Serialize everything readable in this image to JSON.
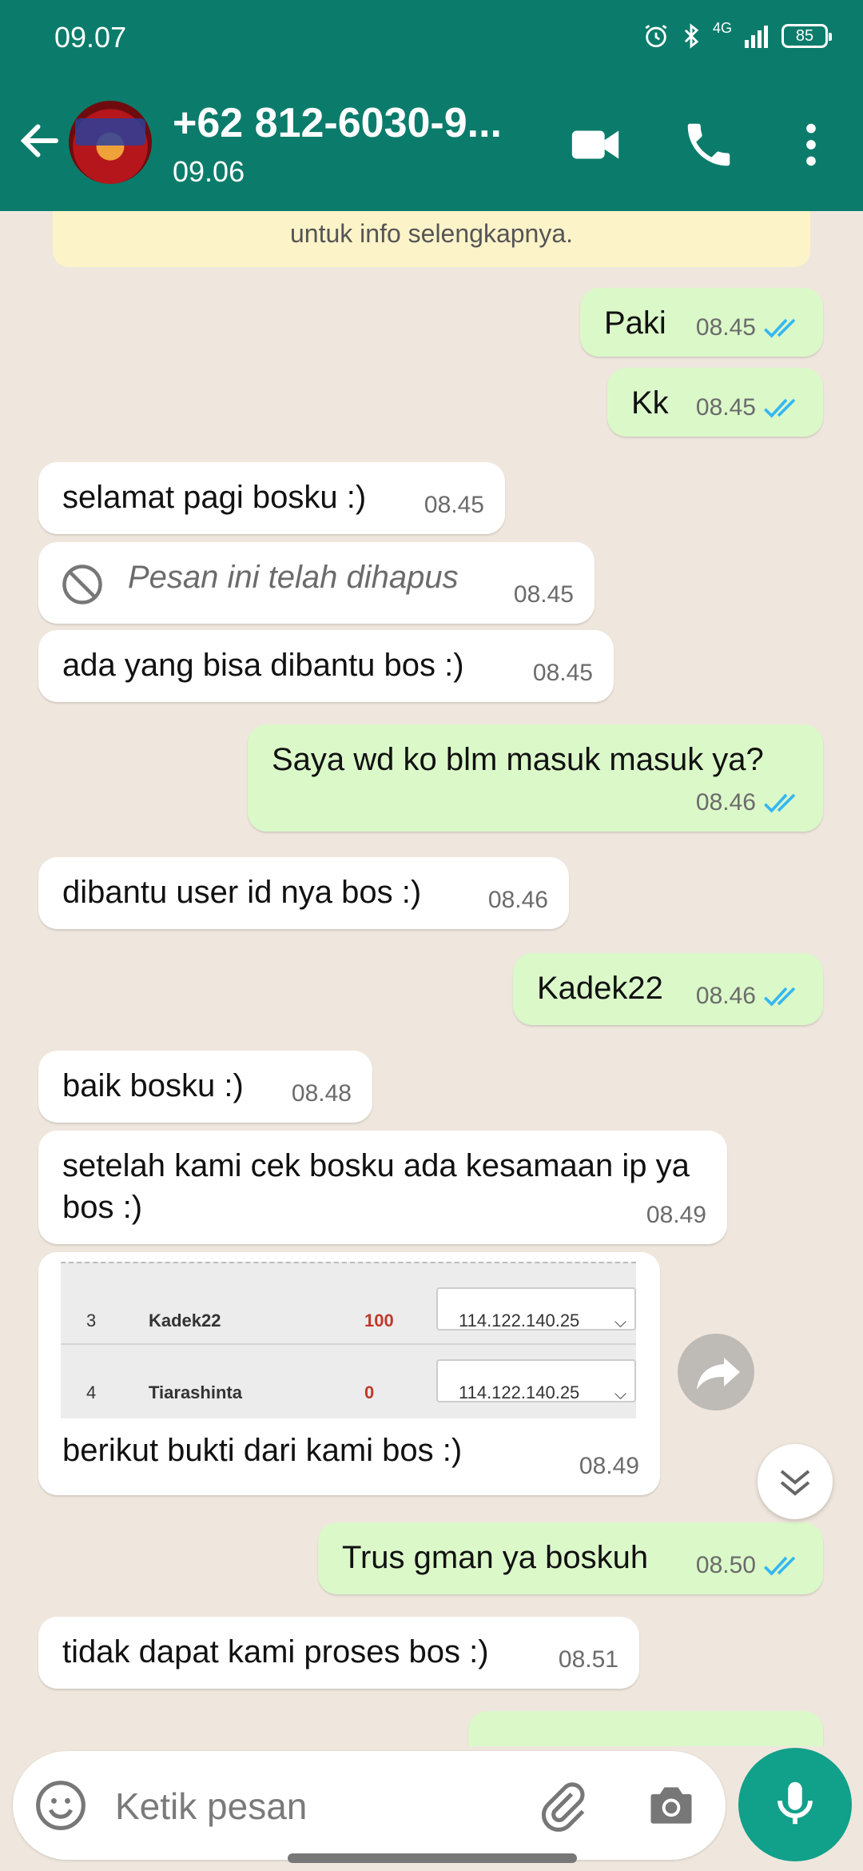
{
  "status_bar": {
    "time": "09.07",
    "network": "4G",
    "battery": "85"
  },
  "header": {
    "contact_name": "+62 812-6030-9...",
    "last_seen": "09.06"
  },
  "chat": {
    "notice_text": "untuk info selengkapnya.",
    "messages": [
      {
        "dir": "out",
        "text": "Paki",
        "time": "08.45",
        "read": true
      },
      {
        "dir": "out",
        "text": "Kk",
        "time": "08.45",
        "read": true
      },
      {
        "dir": "in",
        "text": "selamat pagi bosku :)",
        "time": "08.45"
      },
      {
        "dir": "in",
        "text": "Pesan ini telah dihapus",
        "time": "08.45",
        "deleted": true
      },
      {
        "dir": "in",
        "text": "ada  yang bisa dibantu bos :)",
        "time": "08.45"
      },
      {
        "dir": "out",
        "text": "Saya wd ko blm masuk masuk ya?",
        "time": "08.46",
        "read": true
      },
      {
        "dir": "in",
        "text": "dibantu  user id nya bos :)",
        "time": "08.46"
      },
      {
        "dir": "out",
        "text": "Kadek22",
        "time": "08.46",
        "read": true
      },
      {
        "dir": "in",
        "text": "baik bosku :)",
        "time": "08.48"
      },
      {
        "dir": "in",
        "text": "setelah kami cek bosku ada kesamaan ip ya bos :)",
        "time": "08.49"
      },
      {
        "dir": "in",
        "text": "berikut bukti dari kami bos :)",
        "time": "08.49",
        "image": true
      },
      {
        "dir": "out",
        "text": "Trus gman ya boskuh",
        "time": "08.50",
        "read": true
      },
      {
        "dir": "in",
        "text": "tidak dapat kami proses bos :)",
        "time": "08.51"
      }
    ],
    "image_table": [
      {
        "no": "3",
        "user": "Kadek22",
        "value": "100",
        "ip": "114.122.140.25"
      },
      {
        "no": "4",
        "user": "Tiarashinta",
        "value": "0",
        "ip": "114.122.140.25"
      }
    ]
  },
  "composer": {
    "placeholder": "Ketik pesan"
  },
  "colors": {
    "header": "#0b7c6b",
    "out_bubble": "#dbf8c9",
    "in_bubble": "#ffffff",
    "tick": "#34b7f1",
    "mic": "#11a08a"
  }
}
